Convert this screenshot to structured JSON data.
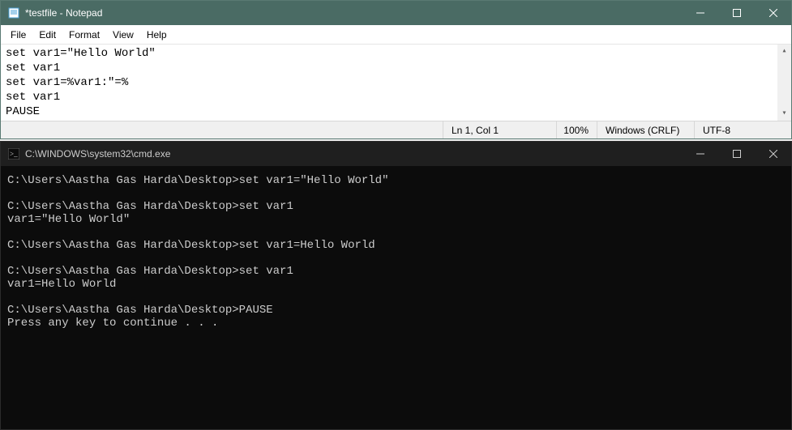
{
  "notepad": {
    "title": "*testfile - Notepad",
    "menus": {
      "file": "File",
      "edit": "Edit",
      "format": "Format",
      "view": "View",
      "help": "Help"
    },
    "content_lines": [
      "set var1=\"Hello World\"",
      "set var1",
      "set var1=%var1:\"=%",
      "set var1",
      "PAUSE"
    ],
    "status": {
      "position": "Ln 1, Col 1",
      "zoom": "100%",
      "line_ending": "Windows (CRLF)",
      "encoding": "UTF-8"
    }
  },
  "cmd": {
    "title": "C:\\WINDOWS\\system32\\cmd.exe",
    "prompt_path": "C:\\Users\\Aastha Gas Harda\\Desktop>",
    "output_lines": [
      "C:\\Users\\Aastha Gas Harda\\Desktop>set var1=\"Hello World\"",
      "",
      "C:\\Users\\Aastha Gas Harda\\Desktop>set var1",
      "var1=\"Hello World\"",
      "",
      "C:\\Users\\Aastha Gas Harda\\Desktop>set var1=Hello World",
      "",
      "C:\\Users\\Aastha Gas Harda\\Desktop>set var1",
      "var1=Hello World",
      "",
      "C:\\Users\\Aastha Gas Harda\\Desktop>PAUSE",
      "Press any key to continue . . ."
    ]
  }
}
